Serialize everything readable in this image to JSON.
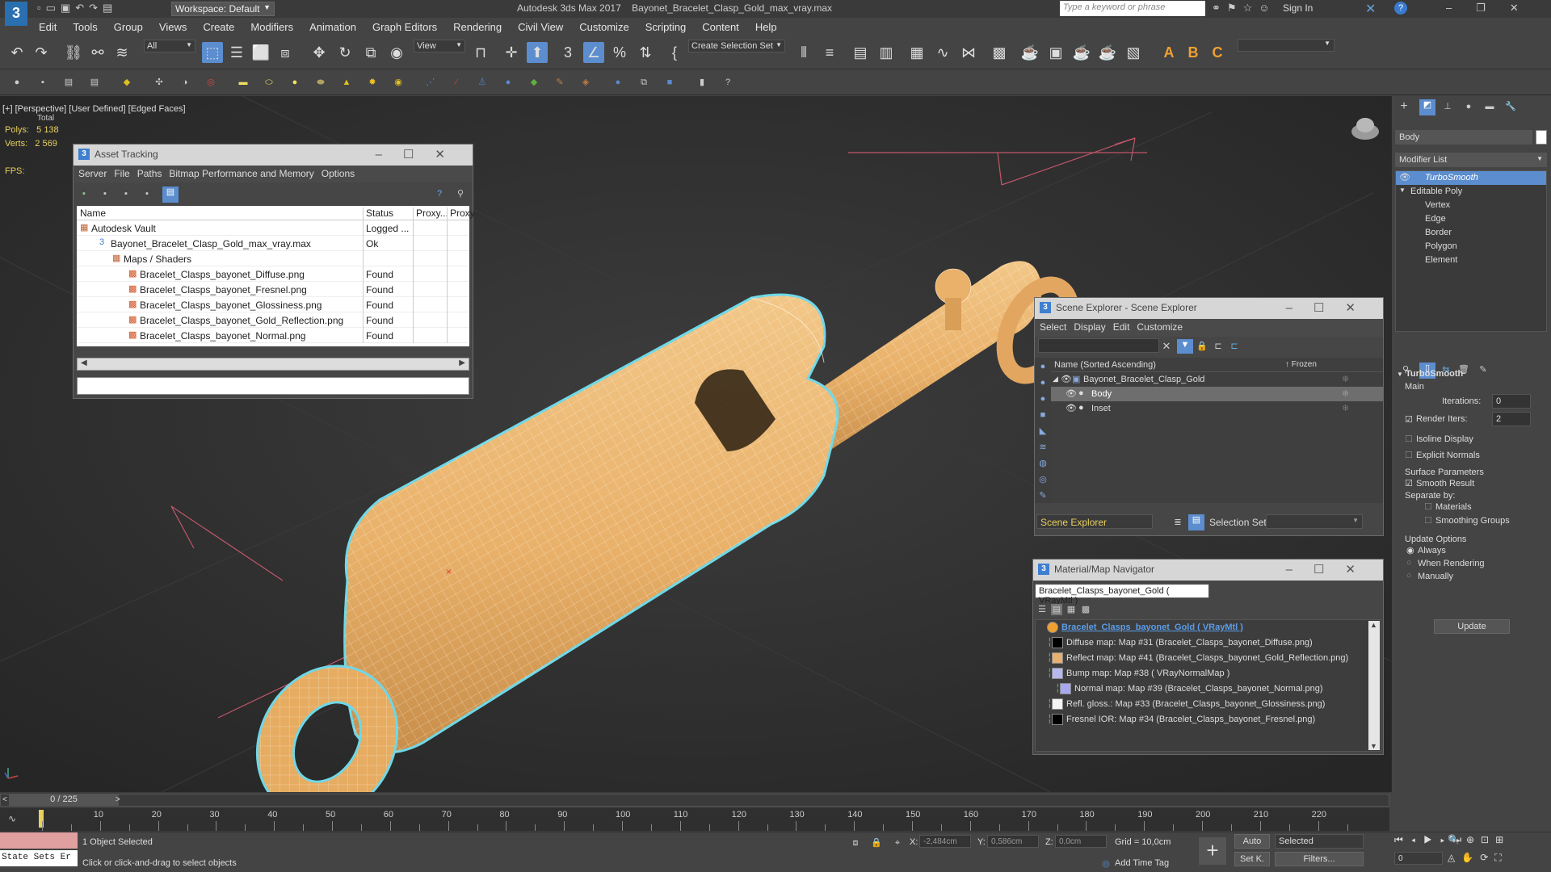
{
  "title_bar": {
    "workspace": "Workspace: Default",
    "app_title": "Autodesk 3ds Max 2017",
    "file_title": "Bayonet_Bracelet_Clasp_Gold_max_vray.max",
    "search_placeholder": "Type a keyword or phrase",
    "sign_in": "Sign In"
  },
  "menu": [
    "Edit",
    "Tools",
    "Group",
    "Views",
    "Create",
    "Modifiers",
    "Animation",
    "Graph Editors",
    "Rendering",
    "Civil View",
    "Customize",
    "Scripting",
    "Content",
    "Help"
  ],
  "toolbar": {
    "filter_all": "All",
    "view_dropdown": "View",
    "create_selection_set": "Create Selection Set"
  },
  "viewport": {
    "label_plus": "[+]",
    "label_view": "[Perspective]",
    "label_shading": "[User Defined]",
    "label_edges": "[Edged Faces]",
    "stats_total": "Total",
    "polys_label": "Polys:",
    "polys_value": "5 138",
    "verts_label": "Verts:",
    "verts_value": "2 569",
    "fps_label": "FPS:"
  },
  "asset_tracking": {
    "title": "Asset Tracking",
    "menu": [
      "Server",
      "File",
      "Paths",
      "Bitmap Performance and Memory",
      "Options"
    ],
    "columns": [
      "Name",
      "Status",
      "Proxy...",
      "Proxy"
    ],
    "rows": [
      {
        "name": "Autodesk Vault",
        "status": "Logged ..."
      },
      {
        "name": "Bayonet_Bracelet_Clasp_Gold_max_vray.max",
        "status": "Ok"
      },
      {
        "name": "Maps / Shaders",
        "status": ""
      },
      {
        "name": "Bracelet_Clasps_bayonet_Diffuse.png",
        "status": "Found"
      },
      {
        "name": "Bracelet_Clasps_bayonet_Fresnel.png",
        "status": "Found"
      },
      {
        "name": "Bracelet_Clasps_bayonet_Glossiness.png",
        "status": "Found"
      },
      {
        "name": "Bracelet_Clasps_bayonet_Gold_Reflection.png",
        "status": "Found"
      },
      {
        "name": "Bracelet_Clasps_bayonet_Normal.png",
        "status": "Found"
      }
    ]
  },
  "scene_explorer": {
    "title": "Scene Explorer - Scene Explorer",
    "menu": [
      "Select",
      "Display",
      "Edit",
      "Customize"
    ],
    "col_name": "Name (Sorted Ascending)",
    "col_frozen": "↑ Frozen",
    "items": [
      "Bayonet_Bracelet_Clasp_Gold",
      "Body",
      "Inset"
    ],
    "footer_label": "Scene Explorer",
    "selection_set": "Selection Set:"
  },
  "material_navigator": {
    "title": "Material/Map Navigator",
    "current": "Bracelet_Clasps_bayonet_Gold  ( VRayMtl )",
    "items": [
      {
        "text": "Bracelet_Clasps_bayonet_Gold  ( VRayMtl )",
        "swatch": "#f0a030"
      },
      {
        "text": "Diffuse map: Map #31 (Bracelet_Clasps_bayonet_Diffuse.png)",
        "swatch": "#000000"
      },
      {
        "text": "Reflect map: Map #41 (Bracelet_Clasps_bayonet_Gold_Reflection.png)",
        "swatch": "#e6b070"
      },
      {
        "text": "Bump map: Map #38  ( VRayNormalMap )",
        "swatch": "#b8b8f0"
      },
      {
        "text": "Normal map: Map #39 (Bracelet_Clasps_bayonet_Normal.png)",
        "swatch": "#a8a8f0"
      },
      {
        "text": "Refl. gloss.: Map #33 (Bracelet_Clasps_bayonet_Glossiness.png)",
        "swatch": "#f4f4f4"
      },
      {
        "text": "Fresnel IOR: Map #34 (Bracelet_Clasps_bayonet_Fresnel.png)",
        "swatch": "#000000"
      }
    ]
  },
  "command_panel": {
    "object_name": "Body",
    "modifier_list": "Modifier List",
    "stack": [
      "TurboSmooth",
      "Editable Poly",
      "Vertex",
      "Edge",
      "Border",
      "Polygon",
      "Element"
    ],
    "rollout_title": "TurboSmooth",
    "main_label": "Main",
    "iterations_label": "Iterations:",
    "iterations_value": "0",
    "render_iters_label": "Render Iters:",
    "render_iters_value": "2",
    "isoline": "Isoline Display",
    "explicit_normals": "Explicit Normals",
    "surface_params": "Surface Parameters",
    "smooth_result": "Smooth Result",
    "separate_by": "Separate by:",
    "materials": "Materials",
    "smoothing_groups": "Smoothing Groups",
    "update_options": "Update Options",
    "always": "Always",
    "when_rendering": "When Rendering",
    "manually": "Manually",
    "update_btn": "Update"
  },
  "timeline": {
    "frame": "0 / 225",
    "ticks": [
      "10",
      "20",
      "30",
      "40",
      "50",
      "60",
      "70",
      "80",
      "90",
      "100",
      "110",
      "120",
      "130",
      "140",
      "150",
      "160",
      "170",
      "180",
      "190",
      "200",
      "210",
      "220"
    ]
  },
  "status": {
    "state_sets": "State Sets Er",
    "selected": "1 Object Selected",
    "hint": "Click or click-and-drag to select objects",
    "x_label": "X:",
    "x_val": "-2,484cm",
    "y_label": "Y:",
    "y_val": "0,586cm",
    "z_label": "Z:",
    "z_val": "0,0cm",
    "grid": "Grid = 10,0cm",
    "add_time_tag": "Add Time Tag",
    "auto": "Auto",
    "set_key": "Set K.",
    "selected_dd": "Selected",
    "filters": "Filters...",
    "frame_val": "0"
  }
}
